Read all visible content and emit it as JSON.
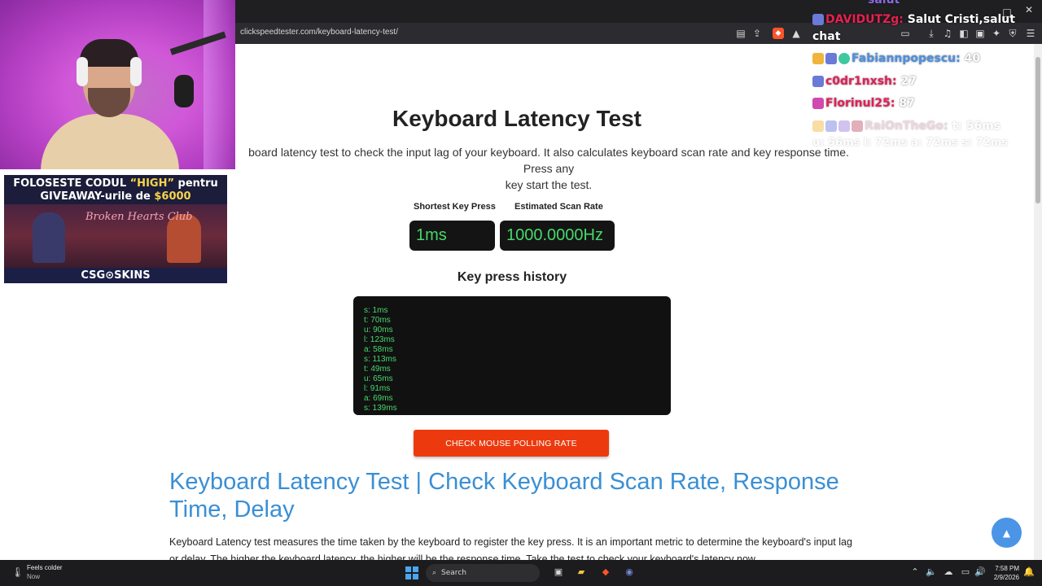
{
  "browser": {
    "url": "clickspeedtester.com/keyboard-latency-test/",
    "toolbar_icons": [
      "reader-icon",
      "share-icon",
      "brave-shield-icon",
      "brave-rewards-icon"
    ],
    "right_icons": [
      "window-icon",
      "download-icon",
      "media-icon",
      "sidebar-icon",
      "wallet-icon",
      "leo-ai-icon",
      "vpn-icon",
      "menu-icon"
    ],
    "window_controls": [
      "minimize",
      "maximize",
      "close"
    ]
  },
  "page": {
    "title": "Keyboard Latency Test",
    "description": "board latency test to check the input lag of your keyboard. It also calculates keyboard scan rate and key response time. Press any\nkey start the test.",
    "stats": [
      {
        "label": "Shortest Key Press",
        "value": "1ms"
      },
      {
        "label": "Estimated Scan Rate",
        "value": "1000.0000Hz"
      }
    ],
    "history_title": "Key press history",
    "history": [
      "s: 1ms",
      "t: 70ms",
      "u: 90ms",
      "l: 123ms",
      "a: 58ms",
      "s: 113ms",
      "t: 49ms",
      "u: 65ms",
      "l: 91ms",
      "a: 69ms",
      "s: 139ms"
    ],
    "cta_label": "CHECK MOUSE POLLING RATE",
    "article_heading": "Keyboard Latency Test | Check Keyboard Scan Rate, Response Time, Delay",
    "article_paragraph": "Keyboard Latency test measures the time taken by the keyboard to register the key press. It is an important metric to determine the keyboard's input lag or delay. The higher the keyboard latency, the higher will be the response time. Take the test to check your keyboard's latency now.",
    "scroll_top_icon": "▲"
  },
  "overlay": {
    "ad_line1_prefix": "FOLOSESTE CODUL ",
    "ad_line1_code": "“HIGH”",
    "ad_line1_suffix": " pentru",
    "ad_line2_prefix": "GIVEAWAY-urile de ",
    "ad_line2_amount": "$6000",
    "ad_neon": "Broken Hearts Club",
    "ad_footer": "CSG⊙SKINS",
    "chat": [
      {
        "user": "DAVIDUTZg:",
        "text": " Salut Cristi,salut",
        "color": "#e8204f"
      },
      {
        "user": "",
        "text": "chat",
        "color": "#ffffff"
      },
      {
        "user": "Fabiannpopescu:",
        "text": " 40",
        "color": "#4a90e2"
      },
      {
        "user": "c0dr1nxsh:",
        "text": " 27",
        "color": "#e0205a"
      },
      {
        "user": "Florinul25:",
        "text": " 87",
        "color": "#e0205a"
      },
      {
        "user": "RaiOnTheGo:",
        "text": " t: 56ms",
        "color": "#d6a3b8"
      },
      {
        "user": "",
        "text": "u: 56ms l: 72ms a: 72ms s: 72ms",
        "color": "#e4d8e0"
      }
    ],
    "chat_top_partial": "salut"
  },
  "taskbar": {
    "weather_line1": "Feels colder",
    "weather_line2": "Now",
    "search_placeholder": "Search",
    "time": "7:58 PM",
    "date": "2/9/2026"
  },
  "colors": {
    "accent_green": "#44d96a",
    "cta_orange": "#ec3a0e",
    "link_blue": "#3a8fd4"
  }
}
